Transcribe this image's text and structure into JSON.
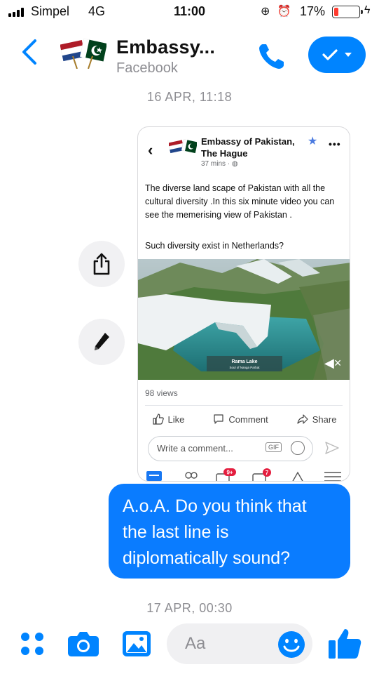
{
  "status_bar": {
    "carrier": "Simpel",
    "network": "4G",
    "time": "11:00",
    "battery_percent": "17%",
    "battery_level": 0.17,
    "icons": [
      "rotation-lock-icon",
      "alarm-icon",
      "charging-bolt-icon"
    ]
  },
  "header": {
    "title": "Embassy...",
    "subtitle": "Facebook",
    "back_icon": "chevron-left-icon",
    "call_icon": "phone-icon",
    "action_icon": "checkmark-dropdown-icon"
  },
  "messages": {
    "date_1": "16 APR, 11:18",
    "date_2": "17 APR, 00:30",
    "shared_post": {
      "page_name": "Embassy of Pakistan, The Hague",
      "time": "37 mins ·",
      "body": "The diverse land scape of Pakistan with all the cultural diversity .In this six minute video you can see the memerising view of Pakistan .",
      "question": "Such diversity exist in Netherlands?",
      "video_caption": "Rama Lake",
      "video_subcaption": "Soul of Nanga Parbat",
      "views": "98 views",
      "like_label": "Like",
      "comment_label": "Comment",
      "share_label": "Share",
      "comment_placeholder": "Write a comment...",
      "gif_label": "GIF",
      "badge_1": "9+",
      "badge_2": "7"
    },
    "outgoing_text": "A.o.A. Do you think that\nthe last line is\ndiplomatically sound?"
  },
  "side_actions": {
    "share_icon": "share-upload-icon",
    "edit_icon": "pencil-icon"
  },
  "composer": {
    "placeholder": "Aa",
    "icons": [
      "apps-grid-icon",
      "camera-icon",
      "image-icon",
      "emoji-icon",
      "thumbs-up-icon"
    ]
  },
  "colors": {
    "accent": "#0084ff",
    "bubble": "#0a7cff",
    "muted_text": "#8e8e93",
    "battery_low": "#ff3b30"
  }
}
